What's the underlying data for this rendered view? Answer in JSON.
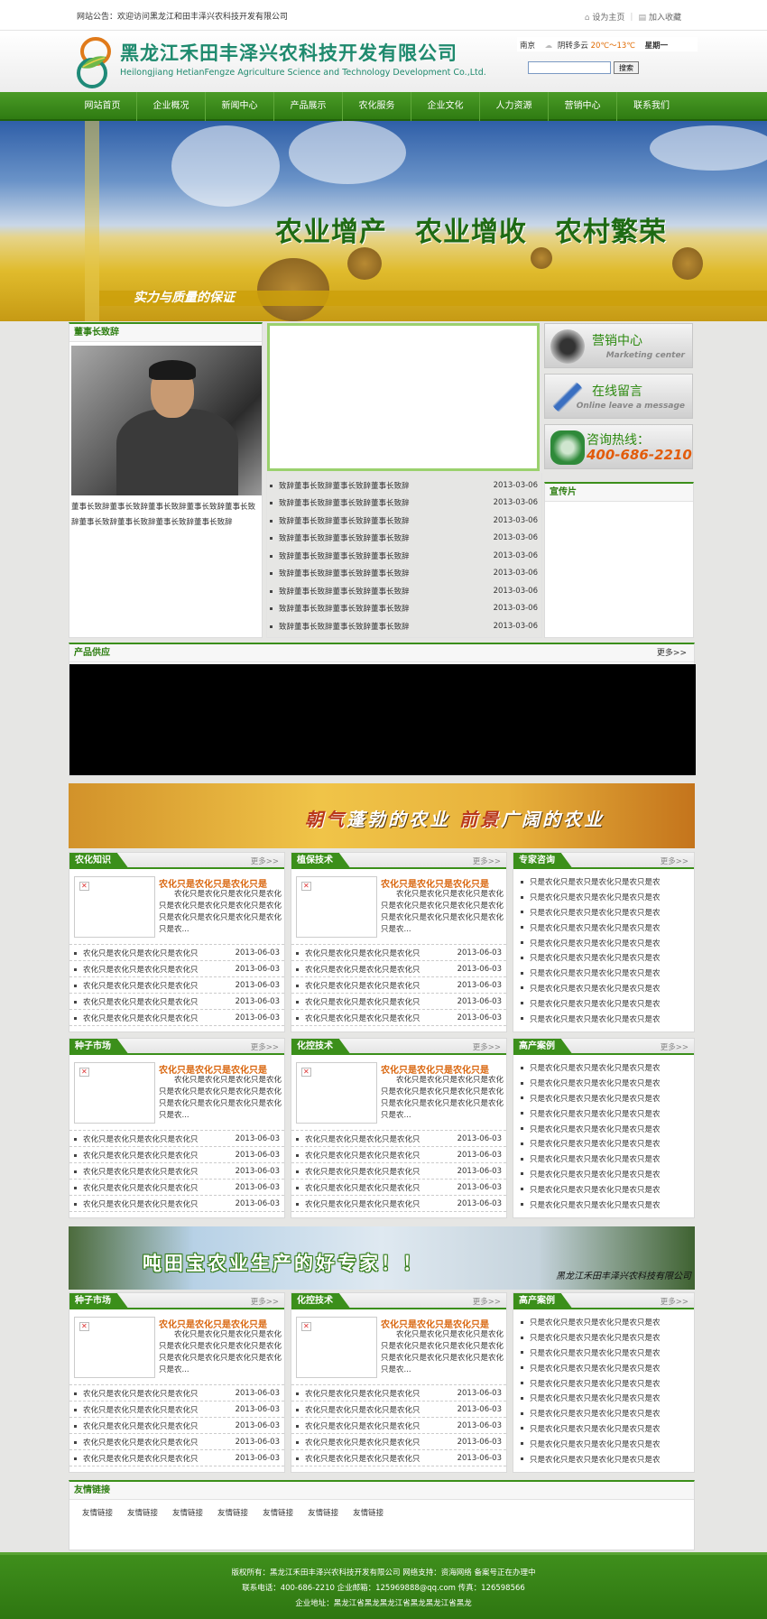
{
  "topbar": {
    "notice": "网站公告：欢迎访问黑龙江和田丰泽兴农科技开发有限公司",
    "set_home": "设为主页",
    "bookmark": "加入收藏",
    "set_home_icon": "home-icon",
    "bookmark_icon": "bookmark-icon"
  },
  "header": {
    "company_cn": "黑龙江禾田丰泽兴农科技开发有限公司",
    "company_en": "Heilongjiang HetianFengze Agriculture Science and Technology Development Co.,Ltd.",
    "weather": {
      "city": "南京",
      "condition": "阴转多云",
      "temp": "20℃～13℃",
      "day": "星期一"
    },
    "search": {
      "value": "",
      "button": "搜索"
    }
  },
  "nav": [
    "网站首页",
    "企业概况",
    "新闻中心",
    "产品展示",
    "农化服务",
    "企业文化",
    "人力资源",
    "营销中心",
    "联系我们"
  ],
  "banner": {
    "slogan": "农业增产　农业增收　农村繁荣",
    "sub": "实力与质量的保证"
  },
  "chairman": {
    "title": "董事长致辞",
    "text": "董事长致辞董事长致辞董事长致辞董事长致辞董事长致辞董事长致辞董事长致辞董事长致辞董事长致辞"
  },
  "news": [
    {
      "title": "致辞董事长致辞董事长致辞董事长致辞",
      "date": "2013-03-06"
    },
    {
      "title": "致辞董事长致辞董事长致辞董事长致辞",
      "date": "2013-03-06"
    },
    {
      "title": "致辞董事长致辞董事长致辞董事长致辞",
      "date": "2013-03-06"
    },
    {
      "title": "致辞董事长致辞董事长致辞董事长致辞",
      "date": "2013-03-06"
    },
    {
      "title": "致辞董事长致辞董事长致辞董事长致辞",
      "date": "2013-03-06"
    },
    {
      "title": "致辞董事长致辞董事长致辞董事长致辞",
      "date": "2013-03-06"
    },
    {
      "title": "致辞董事长致辞董事长致辞董事长致辞",
      "date": "2013-03-06"
    },
    {
      "title": "致辞董事长致辞董事长致辞董事长致辞",
      "date": "2013-03-06"
    },
    {
      "title": "致辞董事长致辞董事长致辞董事长致辞",
      "date": "2013-03-06"
    }
  ],
  "side": {
    "marketing": {
      "title": "营销中心",
      "sub": "Marketing center"
    },
    "message": {
      "title": "在线留言",
      "sub": "Online leave a message"
    },
    "hotline": {
      "title": "咨询热线：",
      "phone": "400-686-2210"
    },
    "promo_title": "宣传片"
  },
  "supply": {
    "title": "产品供应",
    "more": "更多>>"
  },
  "wheat_banner": {
    "a": "朝气",
    "b": "蓬勃的农业 ",
    "c": "前景",
    "d": "广阔的农业"
  },
  "corn_banner": {
    "text": "吨田宝农业生产的好专家！！",
    "company": "黑龙江禾田丰泽兴农科技有限公司"
  },
  "more": "更多>>",
  "feature": {
    "title": "农化只是农化只是农化只是",
    "text": "农化只是农化只是农化只是农化只是农化只是农化只是农化只是农化只是农化只是农化只是农化只是农化只是农..."
  },
  "rowitem": {
    "title": "农化只是农化只是农化只是农化只",
    "date": "2013-06-03"
  },
  "plainitem": "只是农化只是农只是农化只是农只是农",
  "sections": [
    {
      "title": "农化知识",
      "type": "feature"
    },
    {
      "title": "植保技术",
      "type": "feature"
    },
    {
      "title": "专家咨询",
      "type": "list"
    },
    {
      "title": "种子市场",
      "type": "feature"
    },
    {
      "title": "化控技术",
      "type": "feature"
    },
    {
      "title": "高产案例",
      "type": "list"
    },
    {
      "title": "种子市场",
      "type": "feature"
    },
    {
      "title": "化控技术",
      "type": "feature"
    },
    {
      "title": "高产案例",
      "type": "list"
    }
  ],
  "friend_links": {
    "title": "友情链接",
    "items": [
      "友情链接",
      "友情链接",
      "友情链接",
      "友情链接",
      "友情链接",
      "友情链接",
      "友情链接"
    ]
  },
  "footer": {
    "line1": "版权所有：黑龙江禾田丰泽兴农科技开发有限公司 网络支持：资海网络 备案号正在办理中",
    "line2": "联系电话：400-686-2210 企业邮箱：125969888@qq.com 传真：126598566",
    "line3": "企业地址：黑龙江省黑龙黑龙江省黑龙黑龙江省黑龙"
  }
}
